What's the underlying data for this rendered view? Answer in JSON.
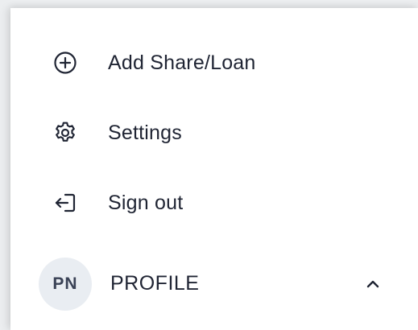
{
  "menu": {
    "items": [
      {
        "label": "Add Share/Loan",
        "icon": "plus-circle-icon"
      },
      {
        "label": "Settings",
        "icon": "gear-icon"
      },
      {
        "label": "Sign out",
        "icon": "sign-out-icon"
      }
    ]
  },
  "profile": {
    "initials": "PN",
    "label": "PROFILE",
    "icon": "chevron-up-icon"
  },
  "colors": {
    "text": "#1f2433",
    "avatar_bg": "#e9edf2",
    "panel_bg": "#ffffff"
  }
}
